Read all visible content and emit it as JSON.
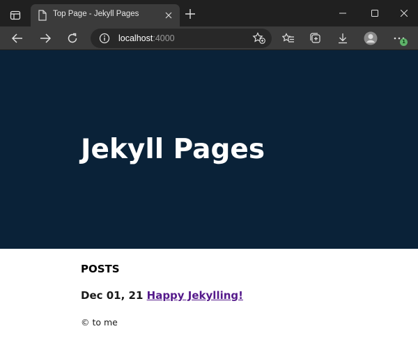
{
  "browser": {
    "tab_title": "Top Page - Jekyll Pages",
    "url_host": "localhost",
    "url_port": ":4000",
    "profile_badge": "1",
    "colors": {
      "tabbar": "#202020",
      "toolbar": "#3b3b3b",
      "hero": "#0a2238",
      "visited_link": "#551a8b"
    }
  },
  "page": {
    "site_title": "Jekyll Pages",
    "posts_heading": "POSTS",
    "posts": [
      {
        "date": "Dec 01, 21",
        "title": "Happy Jekylling!"
      }
    ],
    "footer": "© to me"
  }
}
